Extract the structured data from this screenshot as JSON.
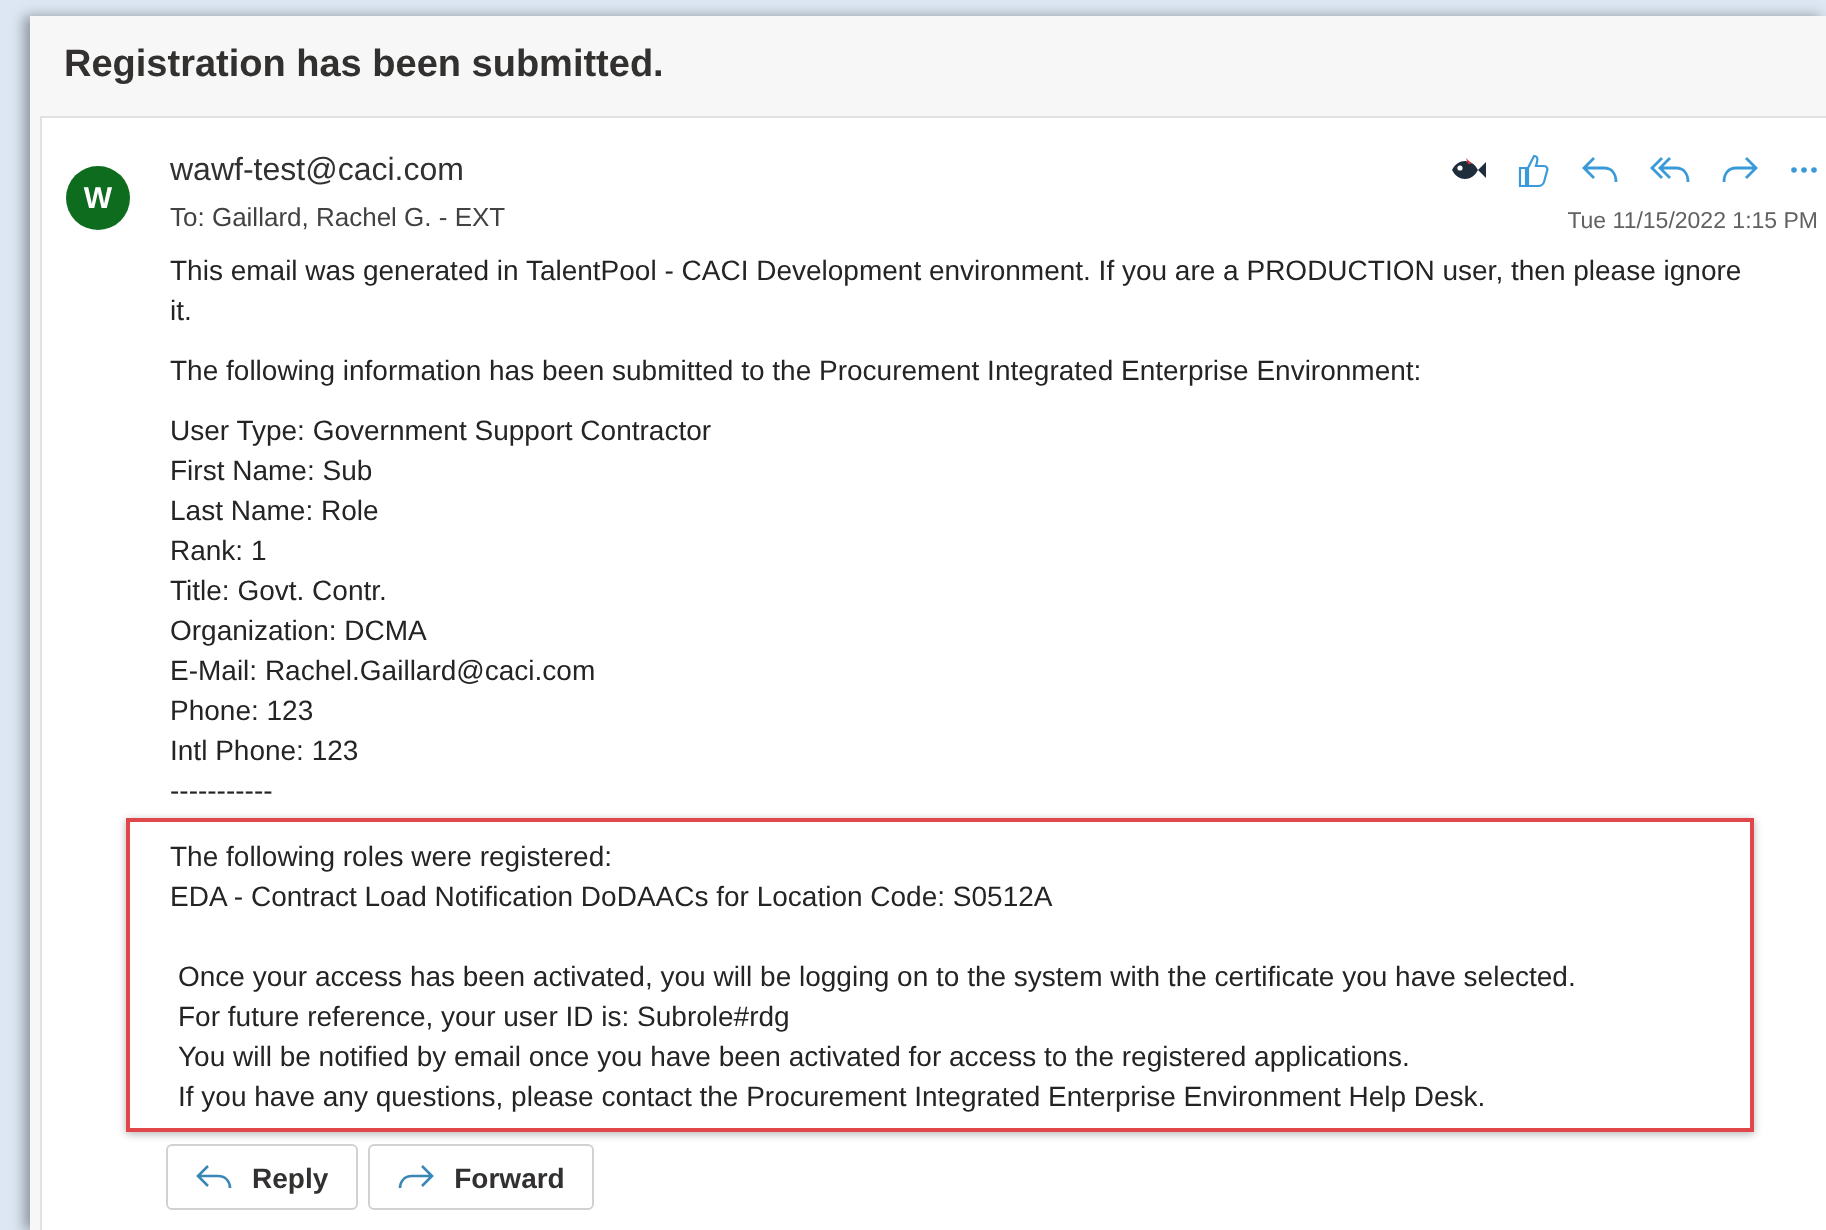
{
  "subject": "Registration has been submitted.",
  "message": {
    "avatar_initial": "W",
    "sender": "wawf-test@caci.com",
    "to": "To:  Gaillard, Rachel G. - EXT",
    "date": "Tue 11/15/2022 1:15 PM",
    "paragraphs": [
      "This email was generated in TalentPool - CACI Development environment. If you are a PRODUCTION user, then please ignore it.",
      "The following information has been submitted to the Procurement Integrated Enterprise Environment:"
    ],
    "details": [
      "User Type: Government Support Contractor",
      "First Name: Sub",
      "Last Name: Role",
      "Rank: 1",
      "Title: Govt. Contr.",
      "Organization: DCMA",
      "E-Mail: Rachel.Gaillard@caci.com",
      "Phone: 123",
      "Intl Phone: 123",
      "-----------"
    ],
    "highlighted": {
      "roles": [
        "The following roles were registered:",
        "EDA - Contract Load Notification DoDAACs for Location Code: S0512A"
      ],
      "notes": [
        "Once your access has been activated, you will be logging on to the system with the certificate you have selected.",
        "For future reference, your user ID is: Subrole#rdg",
        "You will be notified by email once you have been activated for access to the registered applications.",
        "If you have any questions, please contact the Procurement Integrated Enterprise Environment Help Desk."
      ]
    }
  },
  "actions": [
    {
      "kind": "reply",
      "label": "Reply"
    },
    {
      "kind": "forward",
      "label": "Forward"
    }
  ]
}
